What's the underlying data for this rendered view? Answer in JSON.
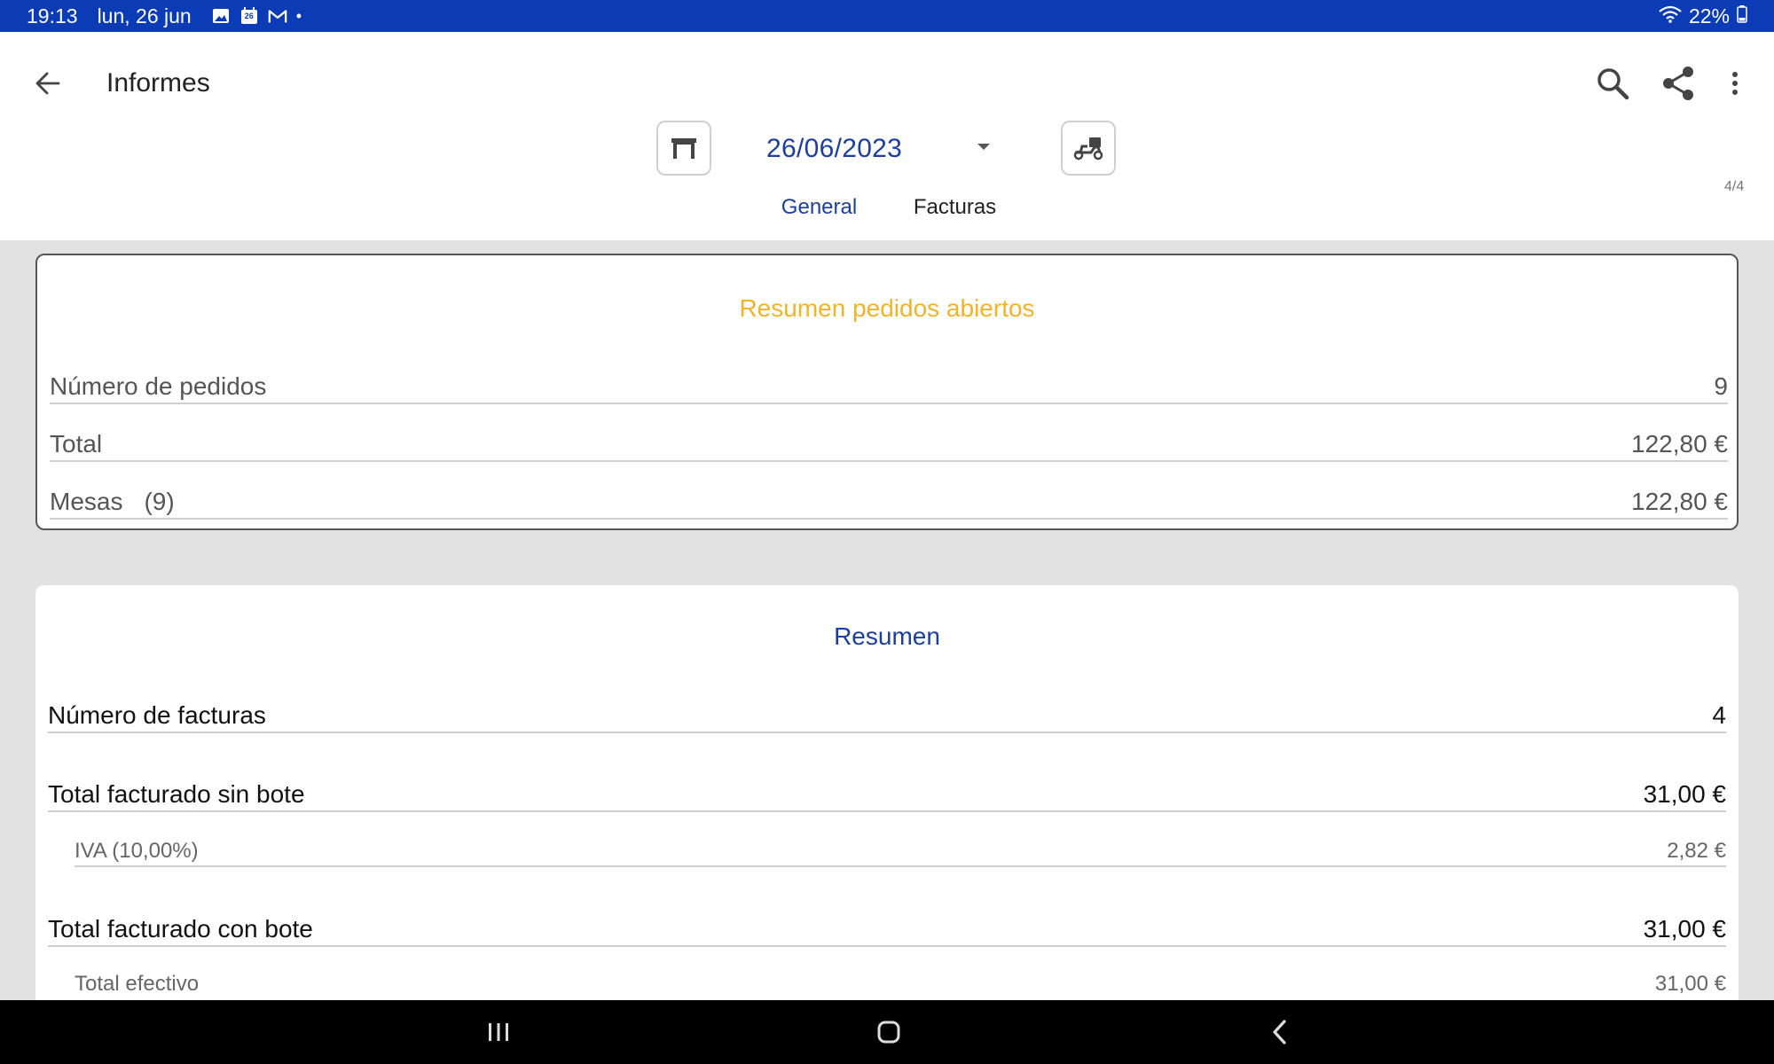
{
  "status_bar": {
    "time": "19:13",
    "date": "lun, 26 jun",
    "notification_icons": [
      "image-icon",
      "calendar-icon",
      "gmail-icon"
    ],
    "calendar_day": "26",
    "dot": "•",
    "battery": "22%"
  },
  "app_bar": {
    "title": "Informes",
    "actions": [
      "search-icon",
      "share-icon",
      "more-vert-icon"
    ]
  },
  "filter": {
    "date": "26/06/2023",
    "left_toggle_icon": "table-icon",
    "right_toggle_icon": "delivery-scooter-icon"
  },
  "page_indicator": "4/4",
  "tabs": [
    {
      "label": "General",
      "selected": true
    },
    {
      "label": "Facturas",
      "selected": false
    }
  ],
  "open_orders": {
    "title": "Resumen pedidos abiertos",
    "rows": [
      {
        "label": "Número de pedidos",
        "value": "9"
      },
      {
        "label": "Total",
        "value": "122,80 €"
      },
      {
        "label": "Mesas",
        "count": "(9)",
        "value": "122,80 €"
      }
    ]
  },
  "summary": {
    "title": "Resumen",
    "rows": [
      {
        "label": "Número de facturas",
        "value": "4"
      },
      {
        "label": "Total facturado sin bote",
        "value": "31,00 €"
      },
      {
        "label": "IVA (10,00%)",
        "value": "2,82 €"
      },
      {
        "label": "Total facturado con bote",
        "value": "31,00 €"
      },
      {
        "label": "Total efectivo",
        "value": "31,00 €"
      }
    ]
  },
  "colors": {
    "status_bar": "#0b3bb5",
    "accent_blue": "#1c3f9d",
    "open_orders_title": "#f0b42c",
    "background": "#e2e2e2"
  }
}
